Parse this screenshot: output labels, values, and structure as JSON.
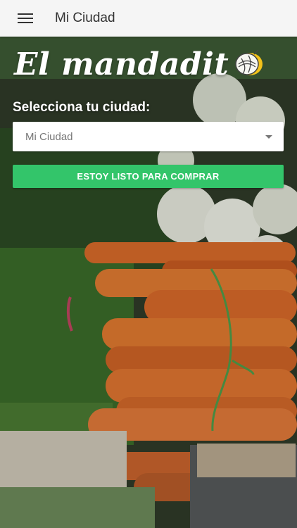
{
  "app_bar": {
    "title": "Mi Ciudad",
    "menu_icon": "hamburger-menu-icon"
  },
  "hero": {
    "logo_text": "El mandadit",
    "logo_icon": "onion-icon",
    "background": "carrots-and-onions-photo"
  },
  "form": {
    "city_label": "Selecciona tu ciudad:",
    "city_select_value": "Mi Ciudad",
    "ready_button_label": "ESTOY LISTO PARA COMPRAR"
  },
  "colors": {
    "app_bar_bg": "#f5f5f5",
    "accent_green": "#33c56a",
    "logo_icon_yellow": "#f3c21a"
  }
}
